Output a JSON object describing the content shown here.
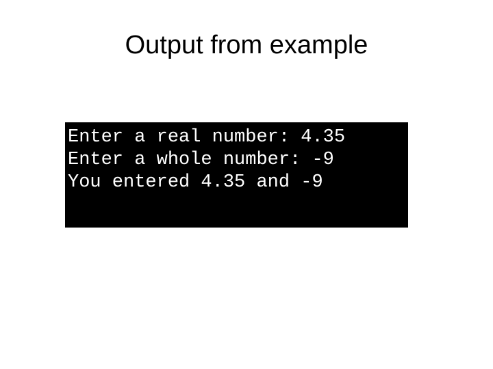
{
  "slide": {
    "title": "Output from example",
    "background_color": "#ffffff",
    "title_color": "#000000"
  },
  "console": {
    "background_color": "#000000",
    "text_color": "#ffffff",
    "lines": [
      "Enter a real number: 4.35",
      "Enter a whole number: -9",
      "You entered 4.35 and -9"
    ]
  }
}
